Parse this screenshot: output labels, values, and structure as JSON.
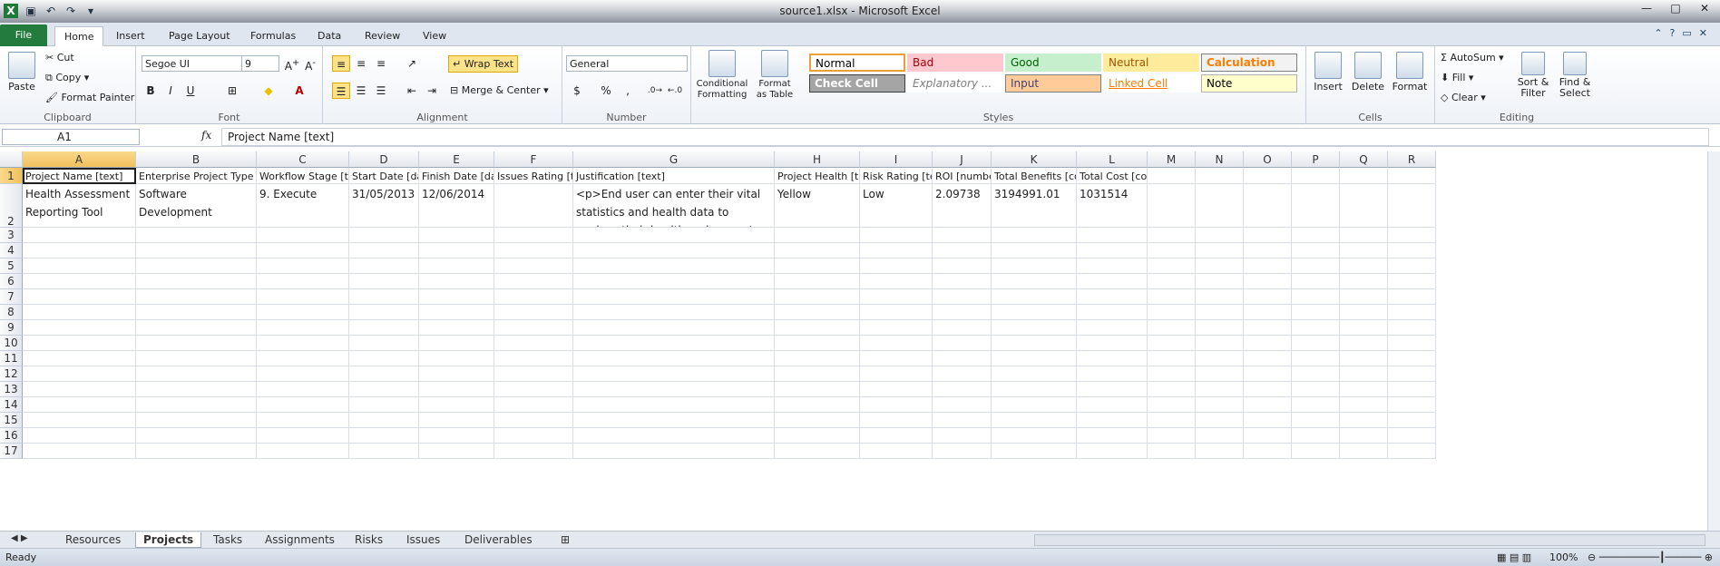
{
  "window": {
    "title": "source1.xlsx - Microsoft Excel"
  },
  "ribbon_tabs": [
    "File",
    "Home",
    "Insert",
    "Page Layout",
    "Formulas",
    "Data",
    "Review",
    "View"
  ],
  "clipboard": {
    "paste": "Paste",
    "cut": "Cut",
    "copy": "Copy",
    "format_painter": "Format Painter",
    "label": "Clipboard"
  },
  "font": {
    "name": "Segoe UI",
    "size": "9",
    "label": "Font",
    "bold": "B",
    "italic": "I",
    "underline": "U"
  },
  "alignment": {
    "wrap_text": "Wrap Text",
    "merge_center": "Merge & Center",
    "label": "Alignment"
  },
  "number": {
    "format": "General",
    "label": "Number",
    "percent": "%",
    "comma": ","
  },
  "styles": {
    "conditional": "Conditional Formatting",
    "format_table": "Format as Table",
    "label": "Styles",
    "cells": [
      {
        "name": "Normal",
        "bg": "#ffffff",
        "fg": "#000000",
        "border": "#e8a03a"
      },
      {
        "name": "Bad",
        "bg": "#ffc7ce",
        "fg": "#9c0006",
        "border": "#ffc7ce"
      },
      {
        "name": "Good",
        "bg": "#c6efce",
        "fg": "#006100",
        "border": "#c6efce"
      },
      {
        "name": "Neutral",
        "bg": "#ffeb9c",
        "fg": "#9c5700",
        "border": "#ffeb9c"
      },
      {
        "name": "Calculation",
        "bg": "#f2f2f2",
        "fg": "#fa7d00",
        "border": "#7f7f7f"
      },
      {
        "name": "Check Cell",
        "bg": "#a5a5a5",
        "fg": "#ffffff",
        "border": "#3f3f3f"
      },
      {
        "name": "Explanatory ...",
        "bg": "#ffffff",
        "fg": "#7f7f7f",
        "border": "#ffffff"
      },
      {
        "name": "Input",
        "bg": "#ffcc99",
        "fg": "#3f3f76",
        "border": "#7f7f7f"
      },
      {
        "name": "Linked Cell",
        "bg": "#ffffff",
        "fg": "#fa7d00",
        "border": "#ffffff"
      },
      {
        "name": "Note",
        "bg": "#ffffcc",
        "fg": "#000000",
        "border": "#b2b2b2"
      }
    ]
  },
  "cells_group": {
    "insert": "Insert",
    "delete": "Delete",
    "format": "Format",
    "label": "Cells"
  },
  "editing": {
    "autosum": "AutoSum",
    "fill": "Fill",
    "clear": "Clear",
    "sort": "Sort & Filter",
    "find": "Find & Select",
    "label": "Editing"
  },
  "formula_bar": {
    "name_box": "A1",
    "fx": "fx",
    "content": "Project Name [text]"
  },
  "columns": [
    "A",
    "B",
    "C",
    "D",
    "E",
    "F",
    "G",
    "H",
    "I",
    "J",
    "K",
    "L",
    "M",
    "N",
    "O",
    "P",
    "Q",
    "R"
  ],
  "rows": [
    "1",
    "2",
    "3",
    "4",
    "5",
    "6",
    "7",
    "8",
    "9",
    "10",
    "11",
    "12",
    "13",
    "14",
    "15",
    "16",
    "17"
  ],
  "header_row": [
    "Project Name [text]",
    "Enterprise Project Type [text]",
    "Workflow Stage [text]",
    "Start Date [date]",
    "Finish Date [date]",
    "Issues Rating [text]",
    "Justification [text]",
    "Project Health [text]",
    "Risk Rating [text]",
    "ROI [number]",
    "Total Benefits [cost]",
    "Total Cost [cost]"
  ],
  "data_row": [
    "Health Assessment Reporting Tool",
    "Software Development",
    "9. Execute",
    "31/05/2013",
    "12/06/2014",
    "",
    "<p>End user can enter their vital statistics and health data to analyze their health and can get customized action plan to improve their health.</p>",
    "Yellow",
    "Low",
    "2.09738",
    "3194991.01",
    "1031514"
  ],
  "sheets": [
    "Resources",
    "Projects",
    "Tasks",
    "Assignments",
    "Risks",
    "Issues",
    "Deliverables"
  ],
  "active_sheet": "Projects",
  "status": {
    "ready": "Ready",
    "zoom": "100%"
  }
}
